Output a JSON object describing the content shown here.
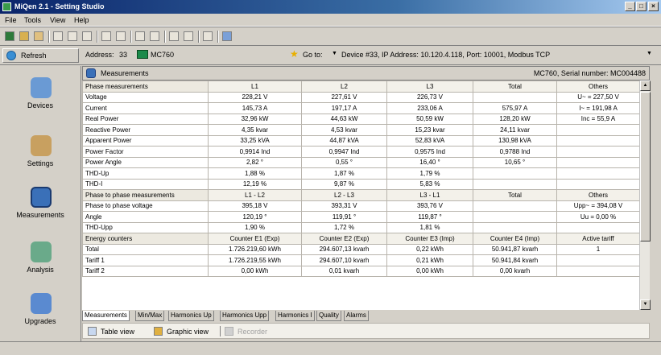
{
  "window": {
    "title": "MiQen 2.1 - Setting Studio",
    "minimize": "_",
    "maximize": "□",
    "close": "×"
  },
  "menu": [
    "File",
    "Tools",
    "View",
    "Help"
  ],
  "addressbar": {
    "refresh_label": "Refresh",
    "address_label": "Address:",
    "address_value": "33",
    "device_name": "MC760",
    "goto_label": "Go to:",
    "goto_destination": "Device #33, IP Address: 10.120.4.118, Port: 10001, Modbus TCP"
  },
  "sidebar": [
    {
      "label": "Devices",
      "icon": "devices-icon",
      "color": "#6a9ad4"
    },
    {
      "label": "Settings",
      "icon": "settings-icon",
      "color": "#c8a060"
    },
    {
      "label": "Measurements",
      "icon": "measurements-icon",
      "color": "#3a70b8"
    },
    {
      "label": "Analysis",
      "icon": "analysis-icon",
      "color": "#6aaa8a"
    },
    {
      "label": "Upgrades",
      "icon": "upgrades-icon",
      "color": "#5a8ad0"
    }
  ],
  "panel": {
    "title": "Measurements",
    "serial": "MC760, Serial number: MC004488"
  },
  "table": [
    {
      "header": true,
      "cells": [
        "Phase measurements",
        "L1",
        "L2",
        "L3",
        "Total",
        "Others"
      ]
    },
    {
      "cells": [
        "Voltage",
        "228,21 V",
        "227,61 V",
        "226,73 V",
        "",
        "U~ = 227,50 V"
      ]
    },
    {
      "cells": [
        "Current",
        "145,73 A",
        "197,17 A",
        "233,06 A",
        "575,97 A",
        "I~ = 191,98 A"
      ]
    },
    {
      "cells": [
        "Real Power",
        "32,96 kW",
        "44,63 kW",
        "50,59 kW",
        "128,20 kW",
        "Inc = 55,9 A"
      ]
    },
    {
      "cells": [
        "Reactive Power",
        "4,35 kvar",
        "4,53 kvar",
        "15,23 kvar",
        "24,11 kvar",
        ""
      ]
    },
    {
      "cells": [
        "Apparent Power",
        "33,25 kVA",
        "44,87 kVA",
        "52,83 kVA",
        "130,98 kVA",
        ""
      ]
    },
    {
      "cells": [
        "Power Factor",
        "0,9914 Ind",
        "0,9947 Ind",
        "0,9575 Ind",
        "0,9788 Ind",
        ""
      ]
    },
    {
      "cells": [
        "Power Angle",
        "2,82 °",
        "0,55 °",
        "16,40 °",
        "10,65 °",
        ""
      ]
    },
    {
      "cells": [
        "THD-Up",
        "1,88 %",
        "1,87 %",
        "1,79 %",
        "",
        ""
      ]
    },
    {
      "cells": [
        "THD-I",
        "12,19 %",
        "9,87 %",
        "5,83 %",
        "",
        ""
      ]
    },
    {
      "header": true,
      "cells": [
        "Phase to phase measurements",
        "L1 - L2",
        "L2 - L3",
        "L3 - L1",
        "Total",
        "Others"
      ]
    },
    {
      "cells": [
        "Phase to phase voltage",
        "395,18 V",
        "393,31 V",
        "393,76 V",
        "",
        "Upp~ = 394,08 V"
      ]
    },
    {
      "cells": [
        "Angle",
        "120,19 °",
        "119,91 °",
        "119,87 °",
        "",
        "Uu = 0,00 %"
      ]
    },
    {
      "cells": [
        "THD-Upp",
        "1,90 %",
        "1,72 %",
        "1,81 %",
        "",
        ""
      ]
    },
    {
      "header": true,
      "cells": [
        "Energy counters",
        "Counter E1 (Exp)",
        "Counter E2 (Exp)",
        "Counter E3 (Imp)",
        "Counter E4 (Imp)",
        "Active tariff"
      ]
    },
    {
      "cells": [
        "Total",
        "1.726.219,60 kWh",
        "294.607,13 kvarh",
        "0,22 kWh",
        "50.941,87 kvarh",
        "1"
      ]
    },
    {
      "cells": [
        "Tariff 1",
        "1.726.219,55 kWh",
        "294.607,10 kvarh",
        "0,21 kWh",
        "50.941,84 kvarh",
        ""
      ]
    },
    {
      "cells": [
        "Tariff 2",
        "0,00 kWh",
        "0,01 kvarh",
        "0,00 kWh",
        "0,00 kvarh",
        ""
      ]
    }
  ],
  "tabs": [
    "Measurements",
    "Min/Max",
    "Harmonics Up",
    "Harmonics Upp",
    "Harmonics I",
    "Quality",
    "Alarms"
  ],
  "viewbar": {
    "table_view": "Table view",
    "graphic_view": "Graphic view",
    "recorder": "Recorder"
  }
}
